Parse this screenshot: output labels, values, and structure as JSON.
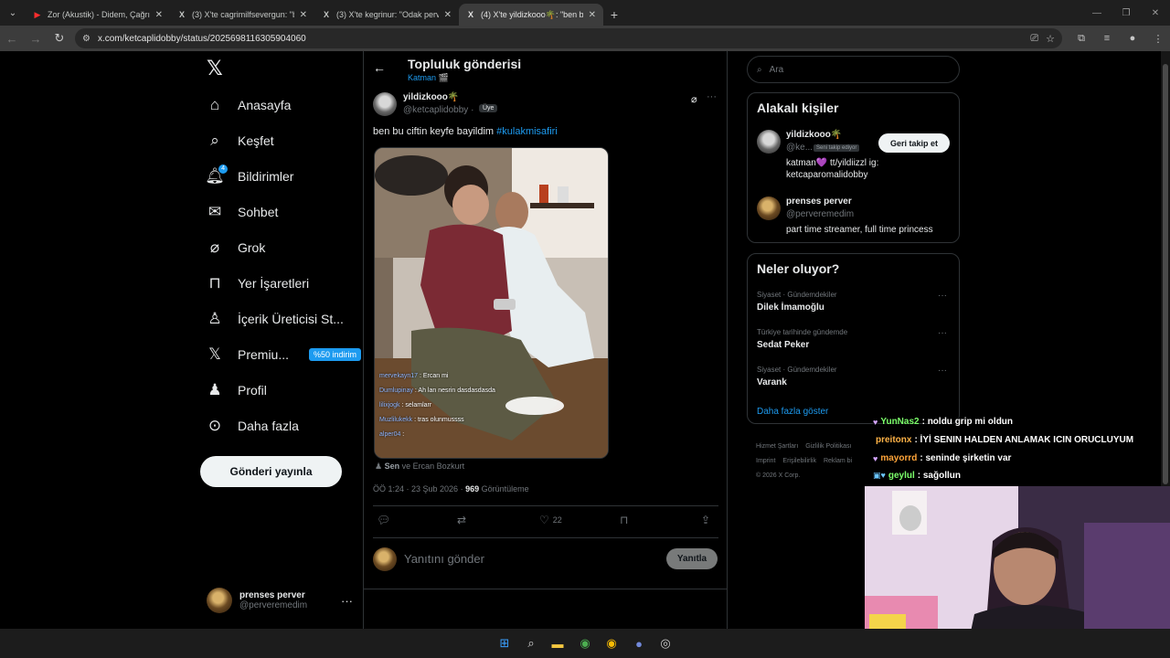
{
  "browser": {
    "tabs": [
      {
        "title": "Zor (Akustik) - Didem, Çağrı Ers",
        "icon": "youtube-icon",
        "active": false
      },
      {
        "title": "(3) X'te cagrimilfsevergun: \"buz",
        "icon": "x-icon",
        "active": false
      },
      {
        "title": "(3) X'te kegrinur: \"Odak perveri",
        "icon": "x-icon",
        "active": false
      },
      {
        "title": "(4) X'te yildizkooo🌴: \"ben bu",
        "icon": "x-icon",
        "active": true
      }
    ],
    "url": "x.com/ketcaplidobby/status/2025698116305904060"
  },
  "nav": {
    "items": [
      {
        "label": "Anasayfa",
        "icon": "home-icon"
      },
      {
        "label": "Keşfet",
        "icon": "search-icon"
      },
      {
        "label": "Bildirimler",
        "icon": "bell-icon",
        "badge": "4"
      },
      {
        "label": "Sohbet",
        "icon": "mail-icon"
      },
      {
        "label": "Grok",
        "icon": "grok-icon"
      },
      {
        "label": "Yer İşaretleri",
        "icon": "bookmark-icon"
      },
      {
        "label": "İçerik Üreticisi St...",
        "icon": "creator-icon"
      },
      {
        "label": "Premiu...",
        "icon": "x-logo-icon",
        "promo": "%50 indirim"
      },
      {
        "label": "Profil",
        "icon": "person-icon"
      },
      {
        "label": "Daha fazla",
        "icon": "more-circle-icon"
      }
    ],
    "post_label": "Gönderi yayınla",
    "account": {
      "name": "prenses perver",
      "handle": "@perveremedim"
    }
  },
  "post": {
    "header_title": "Topluluk gönderisi",
    "header_sub": "Katman 🎬",
    "author_name": "yildizkooo🌴",
    "author_handle": "@ketcaplidobby ·",
    "badge": "Üye",
    "text": "ben bu ciftin keyfe bayildim ",
    "hashtag": "#kulakmisafiri",
    "media_chat": [
      {
        "user": "mervekayn17",
        "msg": "Ercan mi"
      },
      {
        "user": "Dumlupinay",
        "msg": "Ah lan nesrin dasdasdasda"
      },
      {
        "user": "lilixjogk",
        "msg": "selamlarr"
      },
      {
        "user": "Muzlilukekk",
        "msg": "tras olunmussss"
      },
      {
        "user": "alper04",
        "msg": ""
      }
    ],
    "tagged_prefix": "Sen",
    "tagged_rest": " ve Ercan Bozkurt",
    "time": "ÖÖ 1:24 · 23 Şub 2026 · ",
    "views": "969",
    "views_label": " Görüntüleme",
    "likes": "22",
    "reply_placeholder": "Yanıtını gönder",
    "reply_button": "Yanıtla"
  },
  "right": {
    "search_placeholder": "Ara",
    "related_title": "Alakalı kişiler",
    "people": [
      {
        "name": "yildizkooo🌴",
        "handle": "@ke...",
        "follows_you": "Seni takip ediyor",
        "button": "Geri takip et",
        "bio": "katman💜 tt/yildiizzl ig: ketcaparomalidobby"
      },
      {
        "name": "prenses perver",
        "handle": "@perveremedim",
        "bio": "part time streamer, full time princess"
      }
    ],
    "trends_title": "Neler oluyor?",
    "trends": [
      {
        "category": "Siyaset · Gündemdekiler",
        "name": "Dilek İmamoğlu"
      },
      {
        "category": "Türkiye tarihinde gündemde",
        "name": "Sedat Peker"
      },
      {
        "category": "Siyaset · Gündemdekiler",
        "name": "Varank"
      }
    ],
    "show_more": "Daha fazla göster",
    "footer": [
      "Hizmet Şartları",
      "Gizlilik Politikası",
      "Imprint",
      "Erişilebilirlik",
      "Reklam bi",
      "© 2026 X Corp."
    ]
  },
  "stream_chat": [
    {
      "user": "YunNas2",
      "msg": " : noldu grip mi oldun",
      "color": "#7cff6b"
    },
    {
      "user": "preitonx",
      "msg": " : İYİ SENIN HALDEN ANLAMAK ICIN ORUCLUYUM",
      "color": "#ffb347"
    },
    {
      "user": "mayorrd",
      "msg": " : seninde şirketin var",
      "color": "#ffa53a"
    },
    {
      "user": "geylul",
      "msg": " : sağollun",
      "color": "#7cff6b"
    }
  ]
}
